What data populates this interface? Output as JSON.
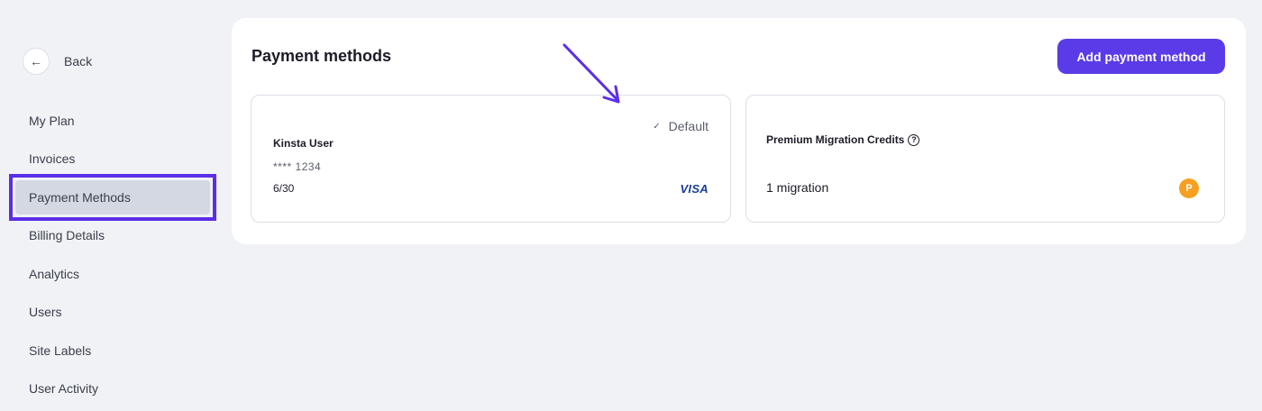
{
  "sidebar": {
    "back_label": "Back",
    "back_icon": "arrow-left-icon",
    "items": [
      {
        "label": "My Plan"
      },
      {
        "label": "Invoices"
      },
      {
        "label": "Payment Methods",
        "active": true
      },
      {
        "label": "Billing Details"
      },
      {
        "label": "Analytics"
      },
      {
        "label": "Users"
      },
      {
        "label": "Site Labels"
      },
      {
        "label": "User Activity"
      }
    ]
  },
  "main": {
    "title": "Payment methods",
    "add_button_label": "Add payment method",
    "card": {
      "default_label": "Default",
      "name": "Kinsta User",
      "number": "**** 1234",
      "expiry": "6/30",
      "brand": "VISA"
    },
    "credits": {
      "title": "Premium Migration Credits",
      "count": "1 migration",
      "help_symbol": "?",
      "coin_symbol": "P"
    }
  },
  "colors": {
    "accent": "#5b3be8",
    "highlight_outline": "#5b2ee8",
    "coin": "#f7a01f",
    "background": "#f0f2f6"
  }
}
